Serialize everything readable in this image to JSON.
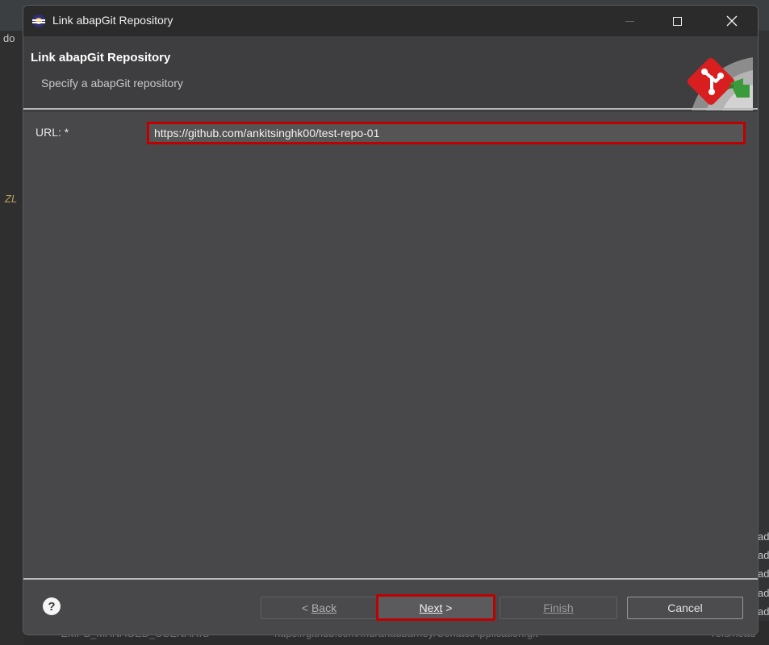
{
  "background_ide": {
    "fragments": [
      "do",
      "ZL",
      "ad",
      "ad",
      "ad",
      "ad",
      "ad"
    ],
    "bottom_row": {
      "name": "ZMPB_MANAGED_SCENARIO",
      "url": "https://github.com/Indranadbarney/ContactApplication.git",
      "ref": "refs/head"
    }
  },
  "dialog": {
    "window_title": "Link abapGit Repository",
    "header_title": "Link abapGit Repository",
    "header_subtitle": "Specify a abapGit repository",
    "url_label": "URL: *",
    "url_value": "https://github.com/ankitsinghk00/test-repo-01",
    "buttons": {
      "back_label": "Back",
      "back_prefix": "< ",
      "next_label": "Next",
      "next_suffix": " >",
      "finish_label": "Finish",
      "cancel_label": "Cancel"
    },
    "help_glyph": "?"
  },
  "colors": {
    "dialog_bg": "#48484a",
    "highlight": "#c00000",
    "titlebar": "#2b2b2b"
  },
  "icons": [
    "eclipse-app-icon",
    "minimize-icon",
    "maximize-icon",
    "close-icon",
    "abapgit-banner-icon",
    "help-icon"
  ]
}
